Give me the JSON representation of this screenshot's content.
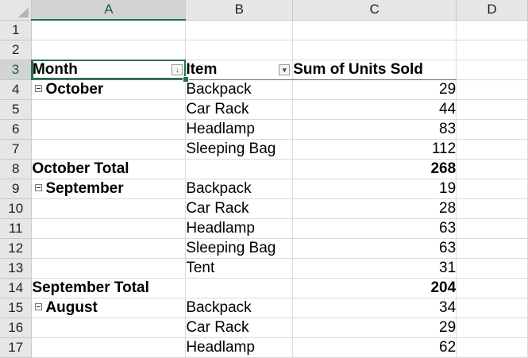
{
  "columns": [
    "A",
    "B",
    "C",
    "D"
  ],
  "rows": [
    {
      "num": "1",
      "a": "",
      "b": "",
      "c": ""
    },
    {
      "num": "2",
      "a": "",
      "b": "",
      "c": ""
    },
    {
      "num": "3",
      "a": "Month",
      "b": "Item",
      "c": "Sum of Units Sold",
      "type": "header"
    },
    {
      "num": "4",
      "a": "October",
      "b": "Backpack",
      "c": "29",
      "type": "group"
    },
    {
      "num": "5",
      "a": "",
      "b": "Car Rack",
      "c": "44"
    },
    {
      "num": "6",
      "a": "",
      "b": "Headlamp",
      "c": "83"
    },
    {
      "num": "7",
      "a": "",
      "b": "Sleeping Bag",
      "c": "112"
    },
    {
      "num": "8",
      "a": "October Total",
      "b": "",
      "c": "268",
      "type": "total"
    },
    {
      "num": "9",
      "a": "September",
      "b": "Backpack",
      "c": "19",
      "type": "group"
    },
    {
      "num": "10",
      "a": "",
      "b": "Car Rack",
      "c": "28"
    },
    {
      "num": "11",
      "a": "",
      "b": "Headlamp",
      "c": "63"
    },
    {
      "num": "12",
      "a": "",
      "b": "Sleeping Bag",
      "c": "63"
    },
    {
      "num": "13",
      "a": "",
      "b": "Tent",
      "c": "31"
    },
    {
      "num": "14",
      "a": "September Total",
      "b": "",
      "c": "204",
      "type": "total"
    },
    {
      "num": "15",
      "a": "August",
      "b": "Backpack",
      "c": "34",
      "type": "group"
    },
    {
      "num": "16",
      "a": "",
      "b": "Car Rack",
      "c": "29"
    },
    {
      "num": "17",
      "a": "",
      "b": "Headlamp",
      "c": "62"
    }
  ],
  "filter_icons": {
    "month": "sort-filter-button-icon",
    "item": "filter-dropdown-icon"
  },
  "colors": {
    "selection": "#217346",
    "header_bg": "#e6e6e6",
    "gridline": "#dadada"
  }
}
